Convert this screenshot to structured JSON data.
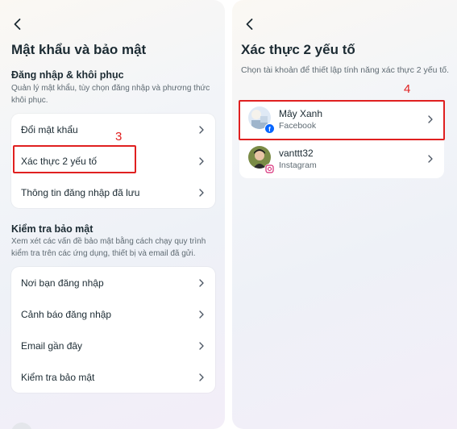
{
  "left": {
    "title": "Mật khẩu và bảo mật",
    "login_section": {
      "title": "Đăng nhập & khôi phục",
      "description": "Quản lý mật khẩu, tùy chọn đăng nhập và phương thức khôi phục.",
      "items": [
        {
          "label": "Đổi mật khẩu"
        },
        {
          "label": "Xác thực 2 yếu tố"
        },
        {
          "label": "Thông tin đăng nhập đã lưu"
        }
      ]
    },
    "security_section": {
      "title": "Kiểm tra bảo mật",
      "description": "Xem xét các vấn đề bảo mật bằng cách chạy quy trình kiểm tra trên các ứng dụng, thiết bị và email đã gửi.",
      "items": [
        {
          "label": "Nơi bạn đăng nhập"
        },
        {
          "label": "Cảnh báo đăng nhập"
        },
        {
          "label": "Email gần đây"
        },
        {
          "label": "Kiểm tra bảo mật"
        }
      ]
    },
    "annotation": "3"
  },
  "right": {
    "title": "Xác thực 2 yếu tố",
    "description": "Chọn tài khoản để thiết lập tính năng xác thực 2 yếu tố.",
    "accounts": [
      {
        "name": "Mây Xanh",
        "platform": "Facebook"
      },
      {
        "name": "vanttt32",
        "platform": "Instagram"
      }
    ],
    "annotation": "4"
  },
  "colors": {
    "annotation": "#e02020",
    "text_primary": "#1c2b33",
    "text_secondary": "#5f6b73",
    "facebook": "#0866ff"
  }
}
